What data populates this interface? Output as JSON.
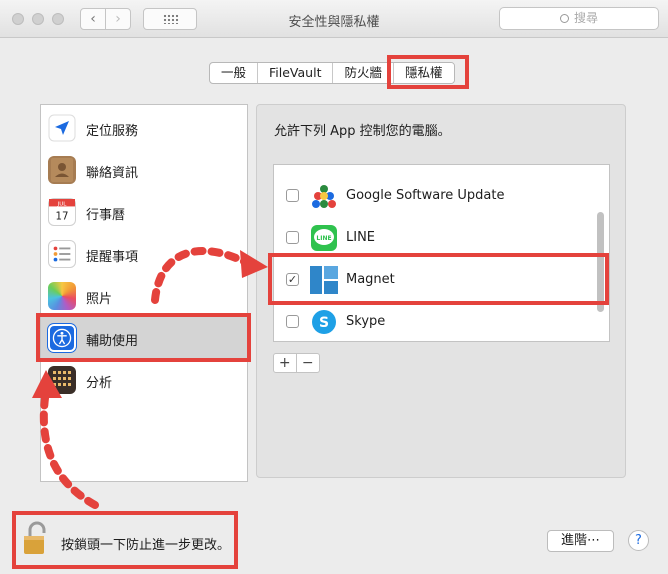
{
  "window": {
    "title": "安全性與隱私權"
  },
  "toolbar": {
    "search_placeholder": "搜尋",
    "back_glyph": "‹",
    "forward_glyph": "›"
  },
  "tabs": [
    {
      "label": "一般"
    },
    {
      "label": "FileVault"
    },
    {
      "label": "防火牆"
    },
    {
      "label": "隱私權",
      "active": true
    }
  ],
  "sidebar": {
    "items": [
      {
        "label": "定位服務",
        "icon": "location-arrow-icon"
      },
      {
        "label": "聯絡資訊",
        "icon": "contacts-icon"
      },
      {
        "label": "行事曆",
        "icon": "calendar-icon",
        "cal_month": "JUL",
        "cal_day": "17"
      },
      {
        "label": "提醒事項",
        "icon": "reminders-icon"
      },
      {
        "label": "照片",
        "icon": "photos-icon"
      },
      {
        "label": "輔助使用",
        "icon": "accessibility-icon",
        "selected": true
      },
      {
        "label": "分析",
        "icon": "analytics-icon"
      }
    ]
  },
  "main": {
    "description": "允許下列 App 控制您的電腦。",
    "apps": [
      {
        "name": "Google Software Update",
        "checked": false,
        "icon": "google-update-icon"
      },
      {
        "name": "LINE",
        "checked": false,
        "icon": "line-icon",
        "icon_text": "LINE"
      },
      {
        "name": "Magnet",
        "checked": true,
        "icon": "magnet-icon"
      },
      {
        "name": "Skype",
        "checked": false,
        "icon": "skype-icon",
        "icon_text": "S"
      }
    ],
    "add_label": "+",
    "remove_label": "−"
  },
  "footer": {
    "lock_text": "按鎖頭一下防止進一步更改。",
    "advanced_label": "進階⋯",
    "help_label": "?"
  },
  "colors": {
    "highlight": "#e4423c",
    "accent": "#1b6ae0"
  }
}
